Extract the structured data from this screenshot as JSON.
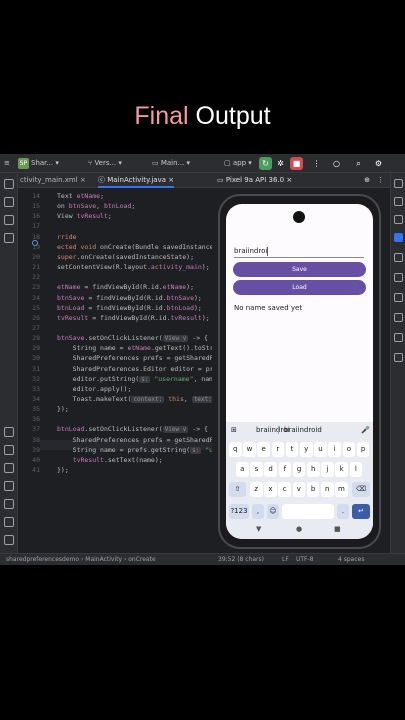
{
  "overlay": {
    "word1": "Final",
    "word2": "Output"
  },
  "toolbar": {
    "project_chip": "SP",
    "project": "Shar...",
    "vcs": "Vers...",
    "file": "Main...",
    "run_config": "app"
  },
  "tabs": [
    {
      "label": "ctivity_main.xml"
    },
    {
      "label": "MainActivity.java"
    }
  ],
  "emulator": {
    "device_label": "Pixel 9a API 36.0"
  },
  "editor": {
    "lines": [
      {
        "num": "14",
        "parts": [
          {
            "t": "Text ",
            "c": ""
          },
          {
            "t": "etName",
            "c": "fd"
          },
          {
            "t": ";",
            "c": ""
          }
        ]
      },
      {
        "num": "15",
        "parts": [
          {
            "t": "on ",
            "c": ""
          },
          {
            "t": "btnSave",
            "c": "fd"
          },
          {
            "t": ", ",
            "c": ""
          },
          {
            "t": "btnLoad",
            "c": "fd"
          },
          {
            "t": ";",
            "c": ""
          }
        ]
      },
      {
        "num": "16",
        "parts": [
          {
            "t": "View ",
            "c": ""
          },
          {
            "t": "tvResult",
            "c": "fd"
          },
          {
            "t": ";",
            "c": ""
          }
        ]
      },
      {
        "num": "17",
        "parts": []
      },
      {
        "num": "18",
        "parts": [
          {
            "t": "rride",
            "c": "kw"
          }
        ]
      },
      {
        "num": "19",
        "parts": [
          {
            "t": "ected void ",
            "c": "kw"
          },
          {
            "t": "onCreate(Bundle savedInstanceState)",
            "c": ""
          }
        ]
      },
      {
        "num": "20",
        "parts": [
          {
            "t": "super",
            "c": "kw"
          },
          {
            "t": ".onCreate(savedInstanceState);",
            "c": ""
          }
        ]
      },
      {
        "num": "21",
        "parts": [
          {
            "t": "setContentView(R.layout.",
            "c": ""
          },
          {
            "t": "activity_main",
            "c": "fd"
          },
          {
            "t": ");",
            "c": ""
          }
        ]
      },
      {
        "num": "22",
        "parts": []
      },
      {
        "num": "23",
        "parts": [
          {
            "t": "etName",
            "c": "fd"
          },
          {
            "t": " = findViewById(R.id.",
            "c": ""
          },
          {
            "t": "etName",
            "c": "fd"
          },
          {
            "t": ");",
            "c": ""
          }
        ]
      },
      {
        "num": "24",
        "parts": [
          {
            "t": "btnSave",
            "c": "fd"
          },
          {
            "t": " = findViewById(R.id.",
            "c": ""
          },
          {
            "t": "btnSave",
            "c": "fd"
          },
          {
            "t": ");",
            "c": ""
          }
        ]
      },
      {
        "num": "25",
        "parts": [
          {
            "t": "btnLoad",
            "c": "fd"
          },
          {
            "t": " = findViewById(R.id.",
            "c": ""
          },
          {
            "t": "btnLoad",
            "c": "fd"
          },
          {
            "t": ");",
            "c": ""
          }
        ]
      },
      {
        "num": "26",
        "parts": [
          {
            "t": "tvResult",
            "c": "fd"
          },
          {
            "t": " = findViewById(R.id.",
            "c": ""
          },
          {
            "t": "tvResult",
            "c": "fd"
          },
          {
            "t": ");",
            "c": ""
          }
        ]
      },
      {
        "num": "27",
        "parts": []
      },
      {
        "num": "28",
        "parts": [
          {
            "t": "btnSave",
            "c": "fd"
          },
          {
            "t": ".setOnClickListener(",
            "c": ""
          },
          {
            "t": "View v",
            "c": "hint"
          },
          {
            "t": " -> {",
            "c": ""
          }
        ]
      },
      {
        "num": "29",
        "parts": [
          {
            "t": "    String name = ",
            "c": ""
          },
          {
            "t": "etName",
            "c": "fd"
          },
          {
            "t": ".getText().toString",
            "c": ""
          }
        ]
      },
      {
        "num": "30",
        "parts": [
          {
            "t": "    SharedPreferences prefs = getSharedPrefe",
            "c": ""
          }
        ]
      },
      {
        "num": "31",
        "parts": [
          {
            "t": "    SharedPreferences.Editor editor = prefs",
            "c": ""
          }
        ]
      },
      {
        "num": "32",
        "parts": [
          {
            "t": "    editor.putString(",
            "c": ""
          },
          {
            "t": "s:",
            "c": "hint"
          },
          {
            "t": " ",
            "c": ""
          },
          {
            "t": "\"username\"",
            "c": "st"
          },
          {
            "t": ", name);",
            "c": ""
          }
        ]
      },
      {
        "num": "33",
        "parts": [
          {
            "t": "    editor.apply();",
            "c": ""
          }
        ]
      },
      {
        "num": "34",
        "parts": [
          {
            "t": "    Toast.",
            "c": ""
          },
          {
            "t": "makeText(",
            "c": ""
          },
          {
            "t": "context:",
            "c": "hint"
          },
          {
            "t": " ",
            "c": ""
          },
          {
            "t": "this",
            "c": "kw"
          },
          {
            "t": ", ",
            "c": ""
          },
          {
            "t": "text:",
            "c": "hint"
          },
          {
            "t": " ",
            "c": ""
          },
          {
            "t": "\"",
            "c": "st"
          }
        ]
      },
      {
        "num": "35",
        "parts": [
          {
            "t": "});",
            "c": ""
          }
        ]
      },
      {
        "num": "36",
        "parts": []
      },
      {
        "num": "37",
        "parts": [
          {
            "t": "btnLoad",
            "c": "fd"
          },
          {
            "t": ".setOnClickListener(",
            "c": ""
          },
          {
            "t": "View v",
            "c": "hint"
          },
          {
            "t": " -> {",
            "c": ""
          }
        ]
      },
      {
        "num": "38",
        "parts": [
          {
            "t": "    SharedPreferences prefs = getSharedPrefe",
            "c": ""
          }
        ]
      },
      {
        "num": "39",
        "parts": [
          {
            "t": "    String name = prefs.getString(",
            "c": ""
          },
          {
            "t": "s:",
            "c": "hint"
          },
          {
            "t": " ",
            "c": ""
          },
          {
            "t": "\"use",
            "c": "st"
          }
        ]
      },
      {
        "num": "40",
        "parts": [
          {
            "t": "    ",
            "c": ""
          },
          {
            "t": "tvResult",
            "c": "fd"
          },
          {
            "t": ".setText(name);",
            "c": ""
          }
        ]
      },
      {
        "num": "41",
        "parts": [
          {
            "t": "});",
            "c": ""
          }
        ]
      }
    ]
  },
  "app": {
    "input_value": "braiindroi",
    "save_label": "Save",
    "load_label": "Load",
    "result_text": "No name saved yet"
  },
  "keyboard": {
    "suggestions": [
      "braiindroi",
      "braiindroid"
    ],
    "row1": [
      "q",
      "w",
      "e",
      "r",
      "t",
      "y",
      "u",
      "i",
      "o",
      "p"
    ],
    "row2": [
      "a",
      "s",
      "d",
      "f",
      "g",
      "h",
      "j",
      "k",
      "l"
    ],
    "row3": [
      "z",
      "x",
      "c",
      "v",
      "b",
      "n",
      "m"
    ],
    "symbols_label": "?123",
    "comma": ",",
    "period": "."
  },
  "statusbar": {
    "path1": "sharedpreferencesdemo",
    "path2": "MainActivity",
    "path3": "onCreate",
    "position": "39:52 (8 chars)",
    "line_ending": "LF",
    "encoding": "UTF-8",
    "indent": "4 spaces"
  },
  "colors": {
    "accent": "#6750a4",
    "ide_bg": "#1e1f22",
    "overlay_accent": "#f59aa6"
  }
}
